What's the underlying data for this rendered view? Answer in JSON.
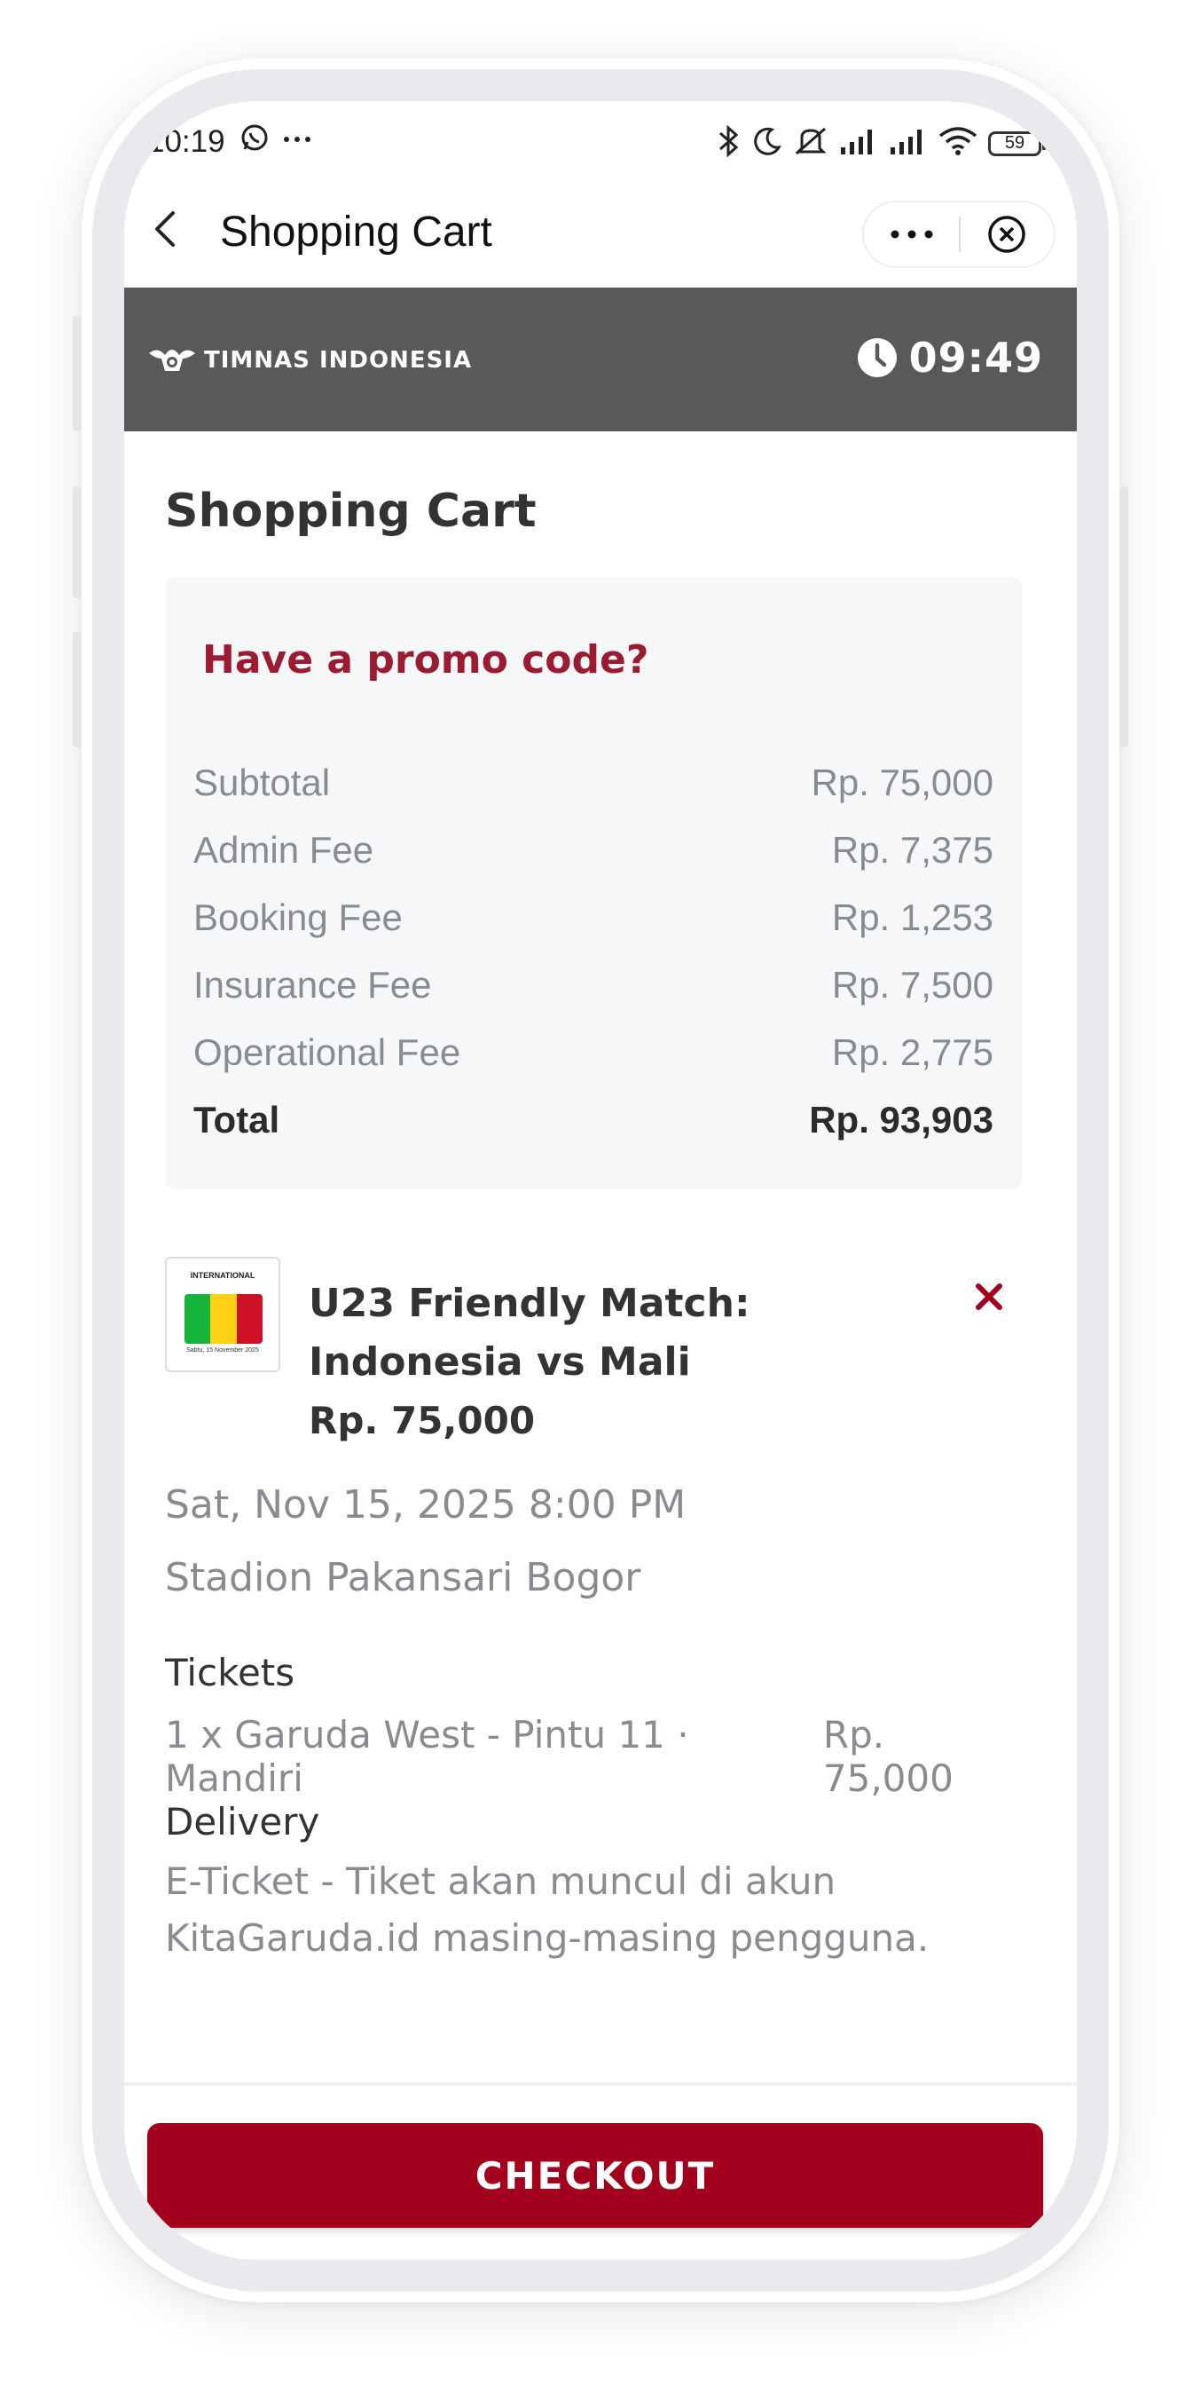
{
  "status_bar": {
    "time": "10:19",
    "battery": "59"
  },
  "nav": {
    "title": "Shopping Cart"
  },
  "banner": {
    "brand": "TIMNAS INDONESIA",
    "timer": "09:49"
  },
  "page": {
    "title": "Shopping Cart"
  },
  "summary": {
    "promo_label": "Have a promo code?",
    "rows": [
      {
        "label": "Subtotal",
        "value": "Rp. 75,000"
      },
      {
        "label": "Admin Fee",
        "value": "Rp. 7,375"
      },
      {
        "label": "Booking Fee",
        "value": "Rp. 1,253"
      },
      {
        "label": "Insurance Fee",
        "value": "Rp. 7,500"
      },
      {
        "label": "Operational Fee",
        "value": "Rp. 2,775"
      }
    ],
    "total": {
      "label": "Total",
      "value": "Rp. 93,903"
    }
  },
  "item": {
    "title": "U23 Friendly Match: Indonesia vs Mali",
    "price": "Rp. 75,000",
    "thumb_header": "INTERNATIONAL",
    "thumb_caption": "Sabtu, 15 November 2025",
    "date": "Sat, Nov 15, 2025 8:00 PM",
    "venue": "Stadion Pakansari Bogor",
    "tickets_label": "Tickets",
    "ticket_desc": "1 x Garuda West - Pintu 11 · Mandiri",
    "ticket_price": "Rp. 75,000",
    "delivery_label": "Delivery",
    "delivery_text": "E-Ticket - Tiket akan muncul di akun KitaGaruda.id masing-masing pengguna."
  },
  "checkout": {
    "label": "CHECKOUT"
  },
  "colors": {
    "accent": "#a3001e",
    "banner": "#58595b",
    "promo": "#9d1b30"
  }
}
